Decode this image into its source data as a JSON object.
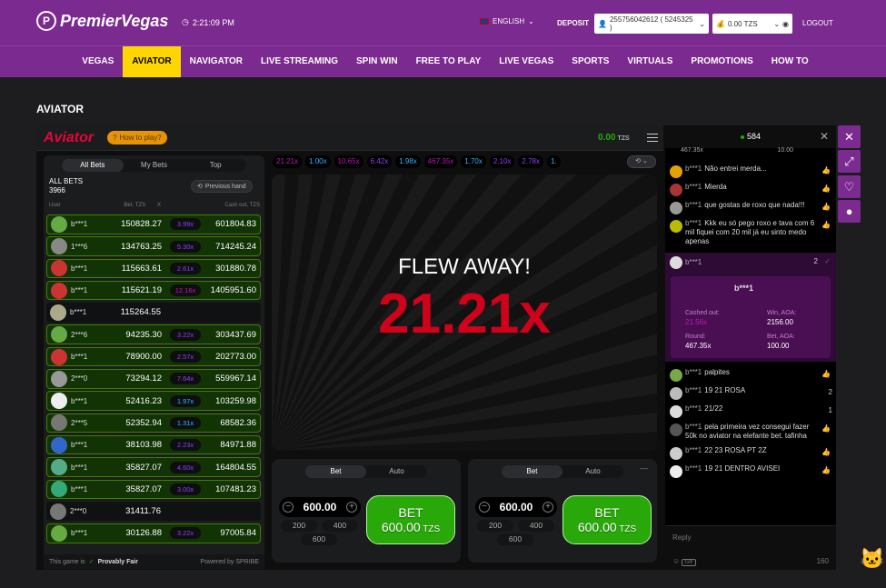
{
  "brand": {
    "name": "PremierVegas"
  },
  "header": {
    "time": "2:21:09 PM",
    "language": "ENGLISH",
    "deposit": "DEPOSIT",
    "account": "255756042612 ( 5245325 )",
    "balance": "0.00 TZS",
    "logout": "LOGOUT"
  },
  "nav": [
    "VEGAS",
    "AVIATOR",
    "NAVIGATOR",
    "LIVE STREAMING",
    "SPIN WIN",
    "FREE TO PLAY",
    "LIVE VEGAS",
    "SPORTS",
    "VIRTUALS",
    "PROMOTIONS",
    "HOW TO"
  ],
  "nav_active": "AVIATOR",
  "page_title": "AVIATOR",
  "game": {
    "logo": "Aviator",
    "how_to_play": "How to play?",
    "balance_value": "0.00",
    "balance_currency": "TZS",
    "tabs": [
      "All Bets",
      "My Bets",
      "Top"
    ],
    "all_bets_label": "ALL BETS",
    "all_bets_count": "3966",
    "previous_hand": "Previous hand",
    "columns": {
      "user": "User",
      "bet": "Bet, TZS",
      "x": "X",
      "cashout": "Cash out, TZS"
    },
    "bets": [
      {
        "user": "b***1",
        "bet": "150828.27",
        "mult": "3.99x",
        "cash": "601804.83",
        "mcolor": "#913ef8",
        "win": true
      },
      {
        "user": "1***6",
        "bet": "134763.25",
        "mult": "5.30x",
        "cash": "714245.24",
        "mcolor": "#913ef8",
        "win": true
      },
      {
        "user": "b***1",
        "bet": "115663.61",
        "mult": "2.61x",
        "cash": "301880.78",
        "mcolor": "#913ef8",
        "win": true
      },
      {
        "user": "b***1",
        "bet": "115621.19",
        "mult": "12.16x",
        "cash": "1405951.60",
        "mcolor": "#c017b4",
        "win": true
      },
      {
        "user": "b***1",
        "bet": "115264.55",
        "mult": "",
        "cash": "",
        "mcolor": "",
        "win": false
      },
      {
        "user": "2***6",
        "bet": "94235.30",
        "mult": "3.22x",
        "cash": "303437.69",
        "mcolor": "#913ef8",
        "win": true
      },
      {
        "user": "b***1",
        "bet": "78900.00",
        "mult": "2.57x",
        "cash": "202773.00",
        "mcolor": "#913ef8",
        "win": true
      },
      {
        "user": "2***0",
        "bet": "73294.12",
        "mult": "7.64x",
        "cash": "559967.14",
        "mcolor": "#913ef8",
        "win": true
      },
      {
        "user": "b***1",
        "bet": "52416.23",
        "mult": "1.97x",
        "cash": "103259.98",
        "mcolor": "#34b4ff",
        "win": true
      },
      {
        "user": "2***5",
        "bet": "52352.94",
        "mult": "1.31x",
        "cash": "68582.36",
        "mcolor": "#34b4ff",
        "win": true
      },
      {
        "user": "b***1",
        "bet": "38103.98",
        "mult": "2.23x",
        "cash": "84971.88",
        "mcolor": "#913ef8",
        "win": true
      },
      {
        "user": "b***1",
        "bet": "35827.07",
        "mult": "4.60x",
        "cash": "164804.55",
        "mcolor": "#913ef8",
        "win": true
      },
      {
        "user": "b***1",
        "bet": "35827.07",
        "mult": "3.00x",
        "cash": "107481.23",
        "mcolor": "#913ef8",
        "win": true
      },
      {
        "user": "2***0",
        "bet": "31411.76",
        "mult": "",
        "cash": "",
        "mcolor": "",
        "win": false
      },
      {
        "user": "b***1",
        "bet": "30126.88",
        "mult": "3.22x",
        "cash": "97005.84",
        "mcolor": "#913ef8",
        "win": true
      }
    ],
    "history": [
      {
        "v": "21.21x",
        "c": "#c017b4"
      },
      {
        "v": "1.00x",
        "c": "#34b4ff"
      },
      {
        "v": "10.65x",
        "c": "#c017b4"
      },
      {
        "v": "6.42x",
        "c": "#913ef8"
      },
      {
        "v": "1.98x",
        "c": "#34b4ff"
      },
      {
        "v": "467.35x",
        "c": "#c017b4"
      },
      {
        "v": "1.70x",
        "c": "#34b4ff"
      },
      {
        "v": "2.10x",
        "c": "#913ef8"
      },
      {
        "v": "2.78x",
        "c": "#913ef8"
      },
      {
        "v": "1.",
        "c": "#34b4ff"
      }
    ],
    "flew_away": "FLEW AWAY!",
    "final_multiplier": "21.21x",
    "provably_fair_prefix": "This game is",
    "provably_fair": "Provably Fair",
    "powered_by": "Powered by SPRIBE",
    "panels": [
      {
        "tabs": [
          "Bet",
          "Auto"
        ],
        "amount": "600.00",
        "quick": [
          "200",
          "400",
          "600"
        ],
        "bet_label": "BET",
        "bet_amount": "600.00",
        "bet_currency": "TZS"
      },
      {
        "tabs": [
          "Bet",
          "Auto"
        ],
        "amount": "600.00",
        "quick": [
          "200",
          "400",
          "600"
        ],
        "bet_label": "BET",
        "bet_amount": "600.00",
        "bet_currency": "TZS"
      }
    ]
  },
  "chat": {
    "online": "584",
    "clip_top_left": "467.35x",
    "clip_top_right": "10.00",
    "messages_top": [
      {
        "user": "b***1",
        "text": "Não entrei merda..."
      },
      {
        "user": "b***1",
        "text": "Mierda"
      },
      {
        "user": "b***1",
        "text": "que gostas de roxo que nada!!!"
      },
      {
        "user": "b***1",
        "text": "Kkk eu só pego roxo e tava com 6 mil fiquei com 20 mil já eu sinto medo apenas"
      }
    ],
    "share": {
      "user": "b***1",
      "likes": "2",
      "card_user": "b***1",
      "cashed_out_label": "Cashed out:",
      "cashed_out": "21.56x",
      "win_label": "Win, AOA:",
      "win": "2156.00",
      "round_label": "Round:",
      "round": "467.35x",
      "bet_label": "Bet, AOA:",
      "bet": "100.00"
    },
    "messages_bottom": [
      {
        "user": "b***1",
        "text": "palpites",
        "likes": ""
      },
      {
        "user": "b***1",
        "text": "19 21 ROSA",
        "likes": "2"
      },
      {
        "user": "b***1",
        "text": "21/22",
        "likes": "1"
      },
      {
        "user": "b***1",
        "text": "pela primeira vez consegui fazer 50k no aviator na elefante bet. tafinha",
        "likes": ""
      },
      {
        "user": "b***1",
        "text": "22 23 ROSA PT 2Z",
        "likes": ""
      },
      {
        "user": "b***1",
        "text": "19 21 DENTRO AVISEI",
        "likes": ""
      }
    ],
    "reply_placeholder": "Reply",
    "char_count": "160",
    "gif_label": "GIF"
  }
}
